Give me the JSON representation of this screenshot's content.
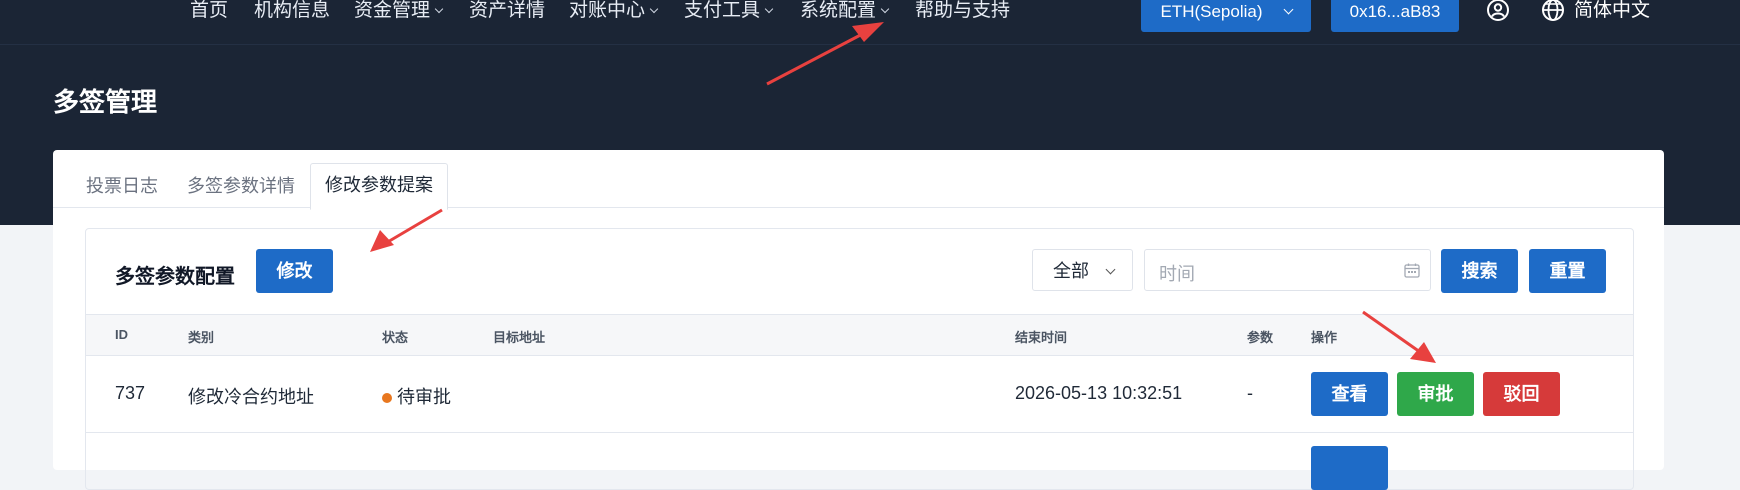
{
  "nav": {
    "items": [
      {
        "label": "首页",
        "dropdown": false
      },
      {
        "label": "机构信息",
        "dropdown": false
      },
      {
        "label": "资金管理",
        "dropdown": true
      },
      {
        "label": "资产详情",
        "dropdown": false
      },
      {
        "label": "对账中心",
        "dropdown": true
      },
      {
        "label": "支付工具",
        "dropdown": true
      },
      {
        "label": "系统配置",
        "dropdown": true
      },
      {
        "label": "帮助与支持",
        "dropdown": false
      }
    ],
    "network": "ETH(Sepolia)",
    "wallet": "0x16...aB83",
    "language": "简体中文",
    "icons": {
      "account": "user-circle-icon",
      "language": "globe-icon"
    }
  },
  "page": {
    "title": "多签管理"
  },
  "tabs": [
    {
      "label": "投票日志",
      "active": false
    },
    {
      "label": "多签参数详情",
      "active": false
    },
    {
      "label": "修改参数提案",
      "active": true
    }
  ],
  "section": {
    "title": "多签参数配置",
    "edit_label": "修改",
    "filter_value": "全部",
    "time_placeholder": "时间",
    "search_label": "搜索",
    "reset_label": "重置"
  },
  "table": {
    "columns": [
      "ID",
      "类别",
      "状态",
      "目标地址",
      "结束时间",
      "参数",
      "操作"
    ],
    "rows": [
      {
        "id": "737",
        "category": "修改冷合约地址",
        "status": "待审批",
        "status_color": "#e8771f",
        "target_address": "",
        "end_time": "2026-05-13 10:32:51",
        "params": "-",
        "actions": {
          "view": "查看",
          "approve": "审批",
          "reject": "驳回"
        }
      }
    ]
  },
  "colors": {
    "primary": "#1e6bc7",
    "success": "#2fa84a",
    "danger": "#d63a3a",
    "header_bg": "#1b2535",
    "annotation": "#e8413f"
  }
}
